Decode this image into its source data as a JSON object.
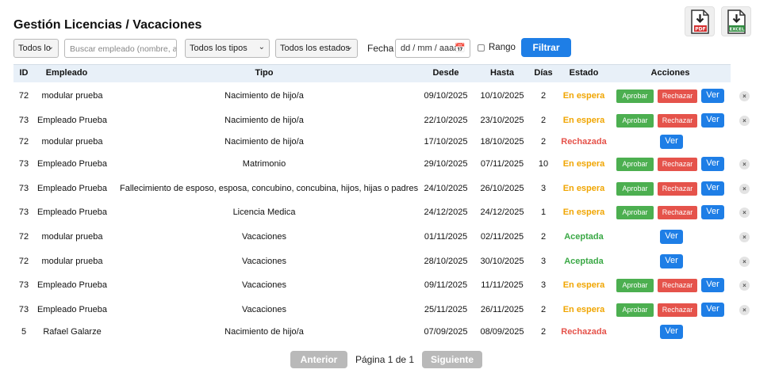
{
  "header": {
    "title": "Gestión Licencias / Vacaciones",
    "pdf_label": "PDF",
    "excel_label": "EXCEL"
  },
  "filters": {
    "empleado_select": "Todos lo",
    "search_placeholder": "Buscar empleado (nombre, a",
    "tipos_select": "Todos los tipos",
    "estados_select": "Todos los estados",
    "fecha_label": "Fecha",
    "date_value": "dd / mm / aaaa",
    "rango_label": "Rango",
    "filtrar_label": "Filtrar"
  },
  "table": {
    "headers": [
      "ID",
      "Empleado",
      "Tipo",
      "Desde",
      "Hasta",
      "Días",
      "Estado",
      "Acciones"
    ],
    "rows": [
      {
        "id": "72",
        "empleado": "modular prueba",
        "tipo": "Nacimiento de hijo/a",
        "desde": "09/10/2025",
        "hasta": "10/10/2025",
        "dias": "2",
        "estado": "En espera"
      },
      {
        "id": "73",
        "empleado": "Empleado Prueba",
        "tipo": "Nacimiento de hijo/a",
        "desde": "22/10/2025",
        "hasta": "23/10/2025",
        "dias": "2",
        "estado": "En espera"
      },
      {
        "id": "72",
        "empleado": "modular prueba",
        "tipo": "Nacimiento de hijo/a",
        "desde": "17/10/2025",
        "hasta": "18/10/2025",
        "dias": "2",
        "estado": "Rechazada"
      },
      {
        "id": "73",
        "empleado": "Empleado Prueba",
        "tipo": "Matrimonio",
        "desde": "29/10/2025",
        "hasta": "07/11/2025",
        "dias": "10",
        "estado": "En espera"
      },
      {
        "id": "73",
        "empleado": "Empleado Prueba",
        "tipo": "Fallecimiento de esposo, esposa, concubino, concubina, hijos, hijas o padres",
        "desde": "24/10/2025",
        "hasta": "26/10/2025",
        "dias": "3",
        "estado": "En espera"
      },
      {
        "id": "73",
        "empleado": "Empleado Prueba",
        "tipo": "Licencia Medica",
        "desde": "24/12/2025",
        "hasta": "24/12/2025",
        "dias": "1",
        "estado": "En espera"
      },
      {
        "id": "72",
        "empleado": "modular prueba",
        "tipo": "Vacaciones",
        "desde": "01/11/2025",
        "hasta": "02/11/2025",
        "dias": "2",
        "estado": "Aceptada"
      },
      {
        "id": "72",
        "empleado": "modular prueba",
        "tipo": "Vacaciones",
        "desde": "28/10/2025",
        "hasta": "30/10/2025",
        "dias": "3",
        "estado": "Aceptada"
      },
      {
        "id": "73",
        "empleado": "Empleado Prueba",
        "tipo": "Vacaciones",
        "desde": "09/11/2025",
        "hasta": "11/11/2025",
        "dias": "3",
        "estado": "En espera"
      },
      {
        "id": "73",
        "empleado": "Empleado Prueba",
        "tipo": "Vacaciones",
        "desde": "25/11/2025",
        "hasta": "26/11/2025",
        "dias": "2",
        "estado": "En espera"
      },
      {
        "id": "5",
        "empleado": "Rafael Galarze",
        "tipo": "Nacimiento de hijo/a",
        "desde": "07/09/2025",
        "hasta": "08/09/2025",
        "dias": "2",
        "estado": "Rechazada"
      }
    ],
    "actions": {
      "aprobar": "Aprobar",
      "rechazar": "Rechazar",
      "ver": "Ver",
      "delete": "×"
    }
  },
  "colors": {
    "en_espera": "#f0a500",
    "rechazada": "#e5534b",
    "aceptada": "#3aa845",
    "primary": "#1e7ee6"
  },
  "pagination": {
    "prev_label": "Anterior",
    "info": "Página 1 de 1",
    "next_label": "Siguiente"
  }
}
